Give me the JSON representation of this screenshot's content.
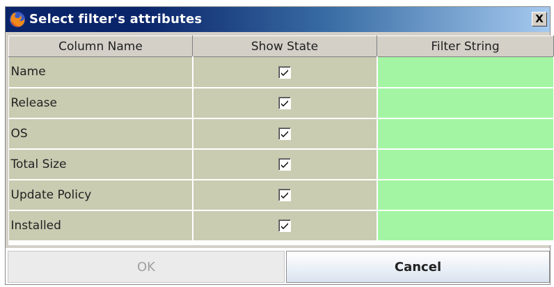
{
  "window": {
    "title": "Select filter's attributes",
    "close_glyph": "X",
    "icon": "firefox-icon"
  },
  "table": {
    "columns": [
      "Column Name",
      "Show State",
      "Filter String"
    ],
    "rows": [
      {
        "name": "Name",
        "show": true,
        "filter": ""
      },
      {
        "name": "Release",
        "show": true,
        "filter": ""
      },
      {
        "name": "OS",
        "show": true,
        "filter": ""
      },
      {
        "name": "Total Size",
        "show": true,
        "filter": ""
      },
      {
        "name": "Update Policy",
        "show": true,
        "filter": ""
      },
      {
        "name": "Installed",
        "show": true,
        "filter": ""
      }
    ]
  },
  "buttons": {
    "ok_label": "OK",
    "cancel_label": "Cancel"
  },
  "colors": {
    "title_bar": "#0a246a",
    "name_cell_bg": "#c9ccb1",
    "filter_cell_bg": "#a3f5a3"
  }
}
